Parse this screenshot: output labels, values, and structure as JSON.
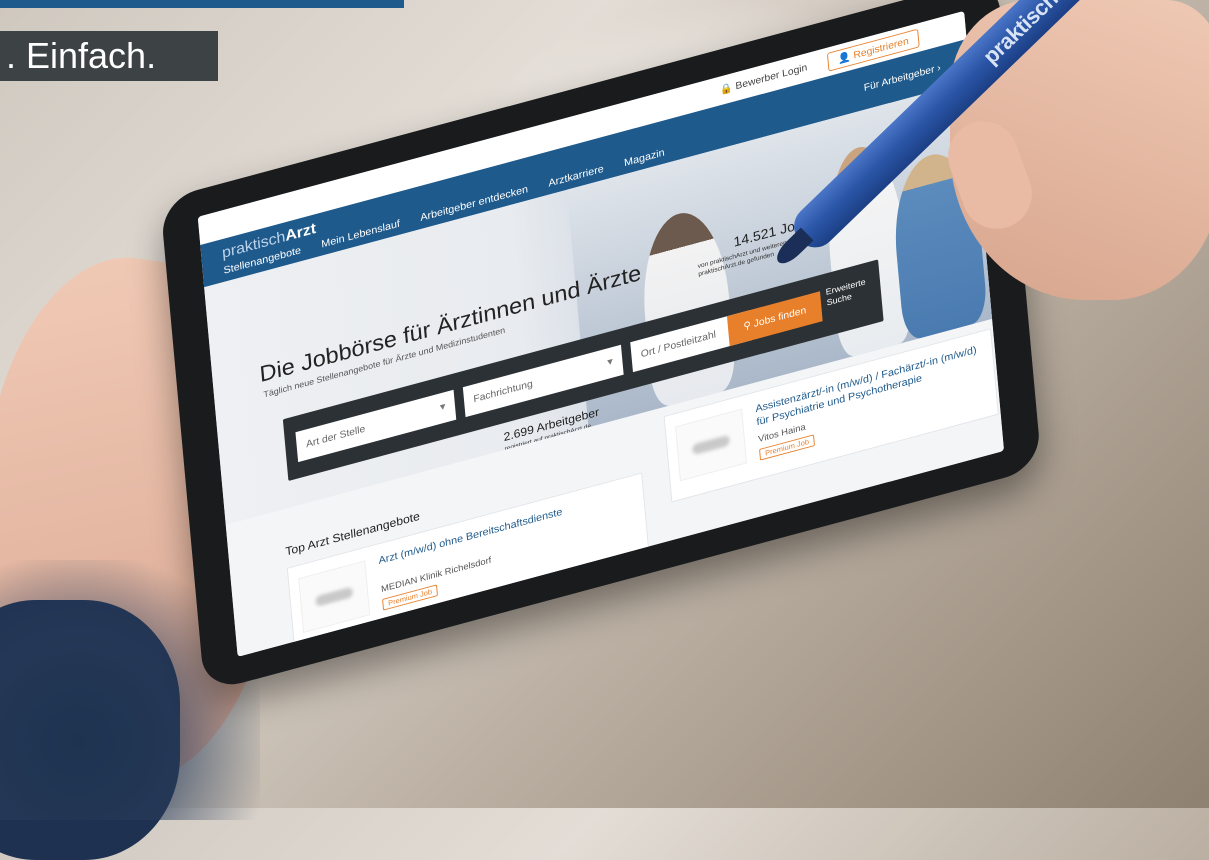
{
  "tagline": ". Einfach.",
  "pen_brand": "praktischArzt",
  "site": {
    "logo_prefix": "praktisch",
    "logo_suffix": "Arzt",
    "bewerber_login": "Bewerber Login",
    "registrieren": "Registrieren",
    "fuer_arbeitgeber": "Für Arbeitgeber ›",
    "nav": [
      "Stellenangebote",
      "Mein Lebenslauf",
      "Arbeitgeber entdecken",
      "Arztkarriere",
      "Magazin"
    ]
  },
  "hero": {
    "title": "Die Jobbörse für Ärztinnen und Ärzte",
    "subtitle": "Täglich neue Stellenangebote für Ärzte und Medizinstudenten",
    "field_type": "Art der Stelle",
    "field_specialty": "Fachrichtung",
    "field_location": "Ort / Postleitzahl",
    "search_button": "Jobs finden",
    "advanced": "Erweiterte Suche",
    "jobs_count": "14.521 Jobs",
    "jobs_note": "von praktischArzt und weiteren Stellenportalen auf praktischArzt.de gefunden",
    "employers_count": "2.699 Arbeitgeber",
    "employers_note": "registriert auf praktischArzt.de"
  },
  "listings": {
    "section_title": "Top Arzt Stellenangebote",
    "jobs": [
      {
        "title": "Arzt (m/w/d) ohne Bereitschaftsdienste",
        "company": "MEDIAN Klinik Richelsdorf",
        "badge": "Premium Job"
      },
      {
        "title": "Assistenzärzt/-in (m/w/d) / Fachärzt/-in (m/w/d) für Psychiatrie und Psychotherapie",
        "company": "Vitos Haina",
        "badge": "Premium Job"
      }
    ]
  },
  "colors": {
    "brand_blue": "#1f5a8c",
    "accent_orange": "#e8802b",
    "pen_blue": "#2a55a6"
  }
}
